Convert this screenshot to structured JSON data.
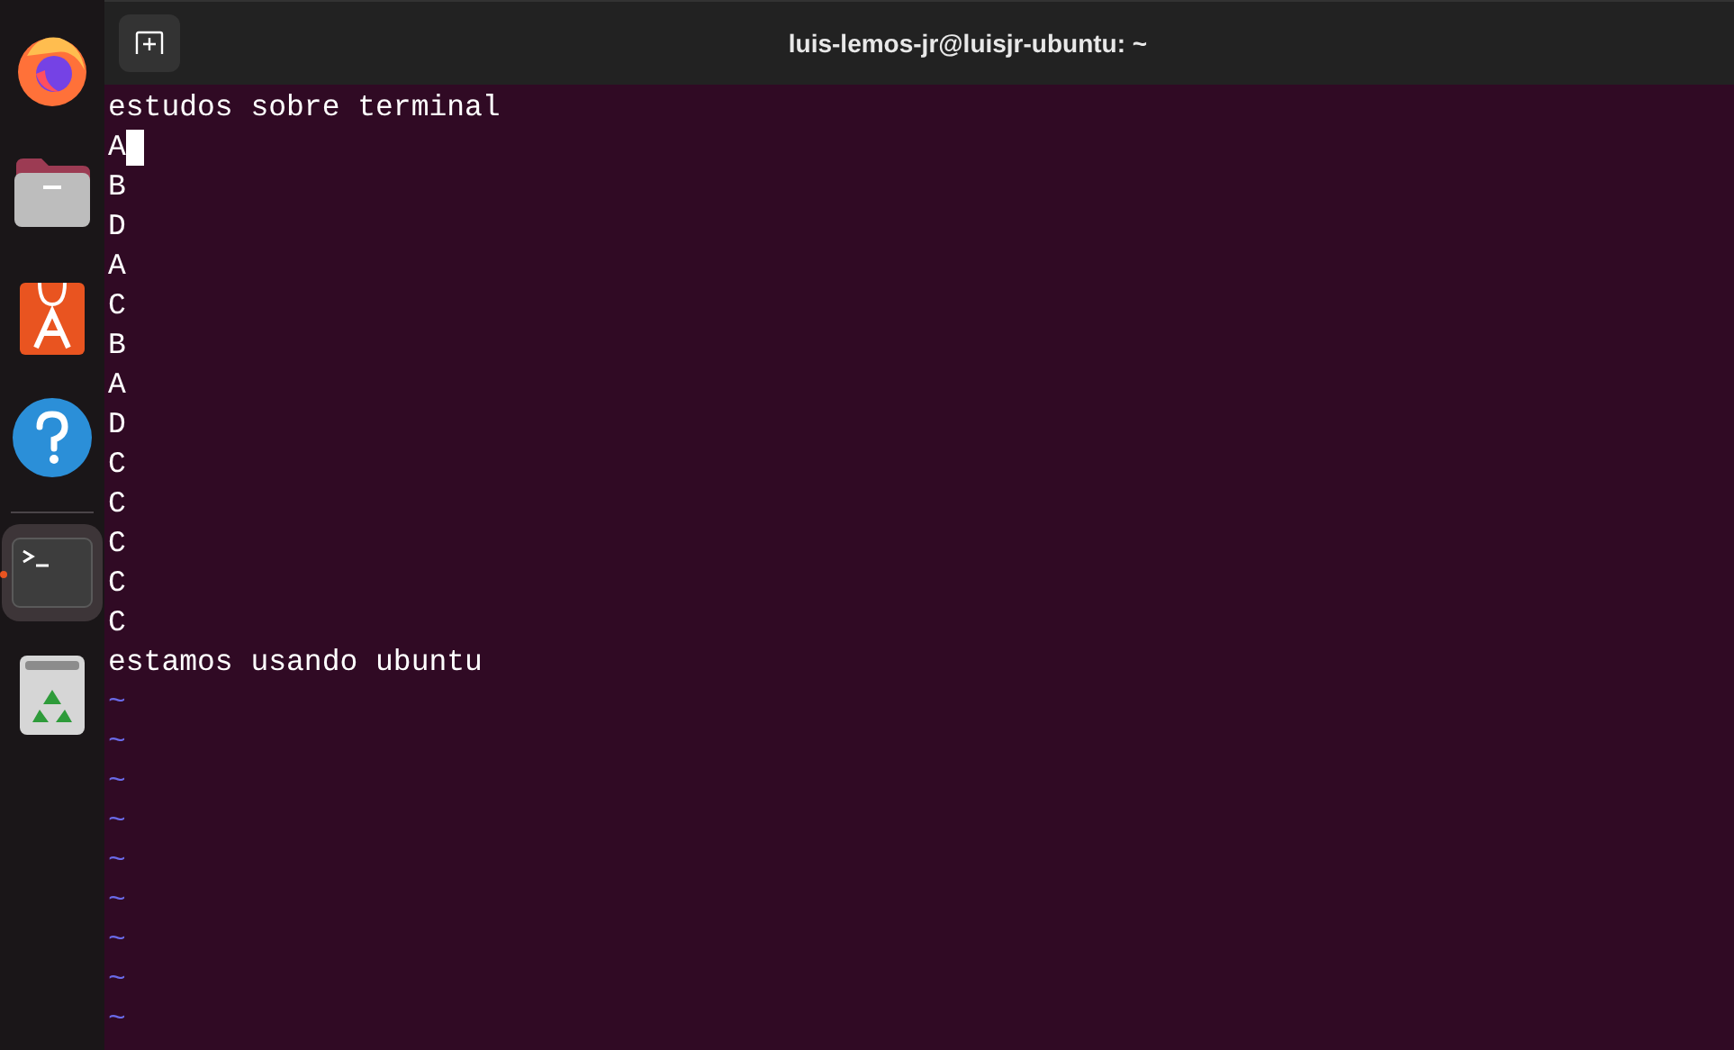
{
  "dock": {
    "items": [
      {
        "kind": "browser",
        "selected": false
      },
      {
        "kind": "files",
        "selected": false
      },
      {
        "kind": "store",
        "selected": false
      },
      {
        "kind": "help",
        "selected": false
      },
      {
        "kind": "terminal",
        "selected": true
      },
      {
        "kind": "trash",
        "selected": false
      }
    ]
  },
  "window": {
    "title": "luis-lemos-jr@luisjr-ubuntu: ~"
  },
  "editor": {
    "lines": [
      {
        "kind": "text",
        "text": "estudos sobre terminal",
        "cursor": false
      },
      {
        "kind": "text",
        "text": "A",
        "cursor": true
      },
      {
        "kind": "text",
        "text": "B",
        "cursor": false
      },
      {
        "kind": "text",
        "text": "D",
        "cursor": false
      },
      {
        "kind": "text",
        "text": "A",
        "cursor": false
      },
      {
        "kind": "text",
        "text": "C",
        "cursor": false
      },
      {
        "kind": "text",
        "text": "B",
        "cursor": false
      },
      {
        "kind": "text",
        "text": "A",
        "cursor": false
      },
      {
        "kind": "text",
        "text": "D",
        "cursor": false
      },
      {
        "kind": "text",
        "text": "C",
        "cursor": false
      },
      {
        "kind": "text",
        "text": "C",
        "cursor": false
      },
      {
        "kind": "text",
        "text": "C",
        "cursor": false
      },
      {
        "kind": "text",
        "text": "C",
        "cursor": false
      },
      {
        "kind": "text",
        "text": "C",
        "cursor": false
      },
      {
        "kind": "text",
        "text": "estamos usando ubuntu",
        "cursor": false
      },
      {
        "kind": "filler",
        "text": "~",
        "cursor": false
      },
      {
        "kind": "filler",
        "text": "~",
        "cursor": false
      },
      {
        "kind": "filler",
        "text": "~",
        "cursor": false
      },
      {
        "kind": "filler",
        "text": "~",
        "cursor": false
      },
      {
        "kind": "filler",
        "text": "~",
        "cursor": false
      },
      {
        "kind": "filler",
        "text": "~",
        "cursor": false
      },
      {
        "kind": "filler",
        "text": "~",
        "cursor": false
      },
      {
        "kind": "filler",
        "text": "~",
        "cursor": false
      },
      {
        "kind": "filler",
        "text": "~",
        "cursor": false
      }
    ]
  }
}
